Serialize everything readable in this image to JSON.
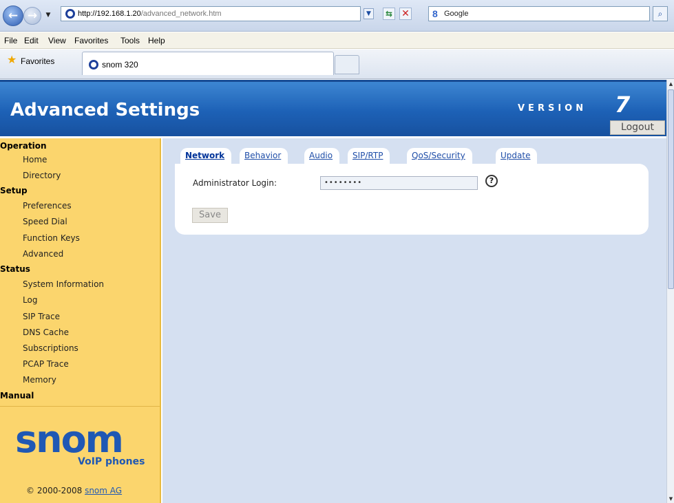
{
  "browser": {
    "url_host": "http://192.168.1.20",
    "url_path": "/advanced_network.htm",
    "search_text": "Google",
    "menu": [
      "File",
      "Edit",
      "View",
      "Favorites",
      "Tools",
      "Help"
    ],
    "favorites_label": "Favorites",
    "tab_title": "snom 320"
  },
  "header": {
    "title": "Advanced Settings",
    "version_label": "VERSION",
    "version_number": "7",
    "logout_label": "Logout",
    "brand_color": "#1d61b6"
  },
  "sidebar": {
    "sections": [
      {
        "label": "Operation",
        "items": [
          "Home",
          "Directory"
        ]
      },
      {
        "label": "Setup",
        "items": [
          "Preferences",
          "Speed Dial",
          "Function Keys",
          "Advanced"
        ]
      },
      {
        "label": "Status",
        "items": [
          "System Information",
          "Log",
          "SIP Trace",
          "DNS Cache",
          "Subscriptions",
          "PCAP Trace",
          "Memory"
        ]
      },
      {
        "label": "Manual",
        "items": []
      }
    ],
    "logo_text": "snom",
    "logo_subtext": "VoIP phones",
    "copyright": "© 2000-2008",
    "copyright_link": "snom AG",
    "bg_color": "#fbd56d"
  },
  "main": {
    "tabs": [
      "Network",
      "Behavior",
      "Audio",
      "SIP/RTP",
      "QoS/Security",
      "Update"
    ],
    "active_tab": "Network",
    "field_label": "Administrator Login:",
    "field_value": "••••••••",
    "save_label": "Save",
    "bg_color": "#d5e0f1"
  }
}
